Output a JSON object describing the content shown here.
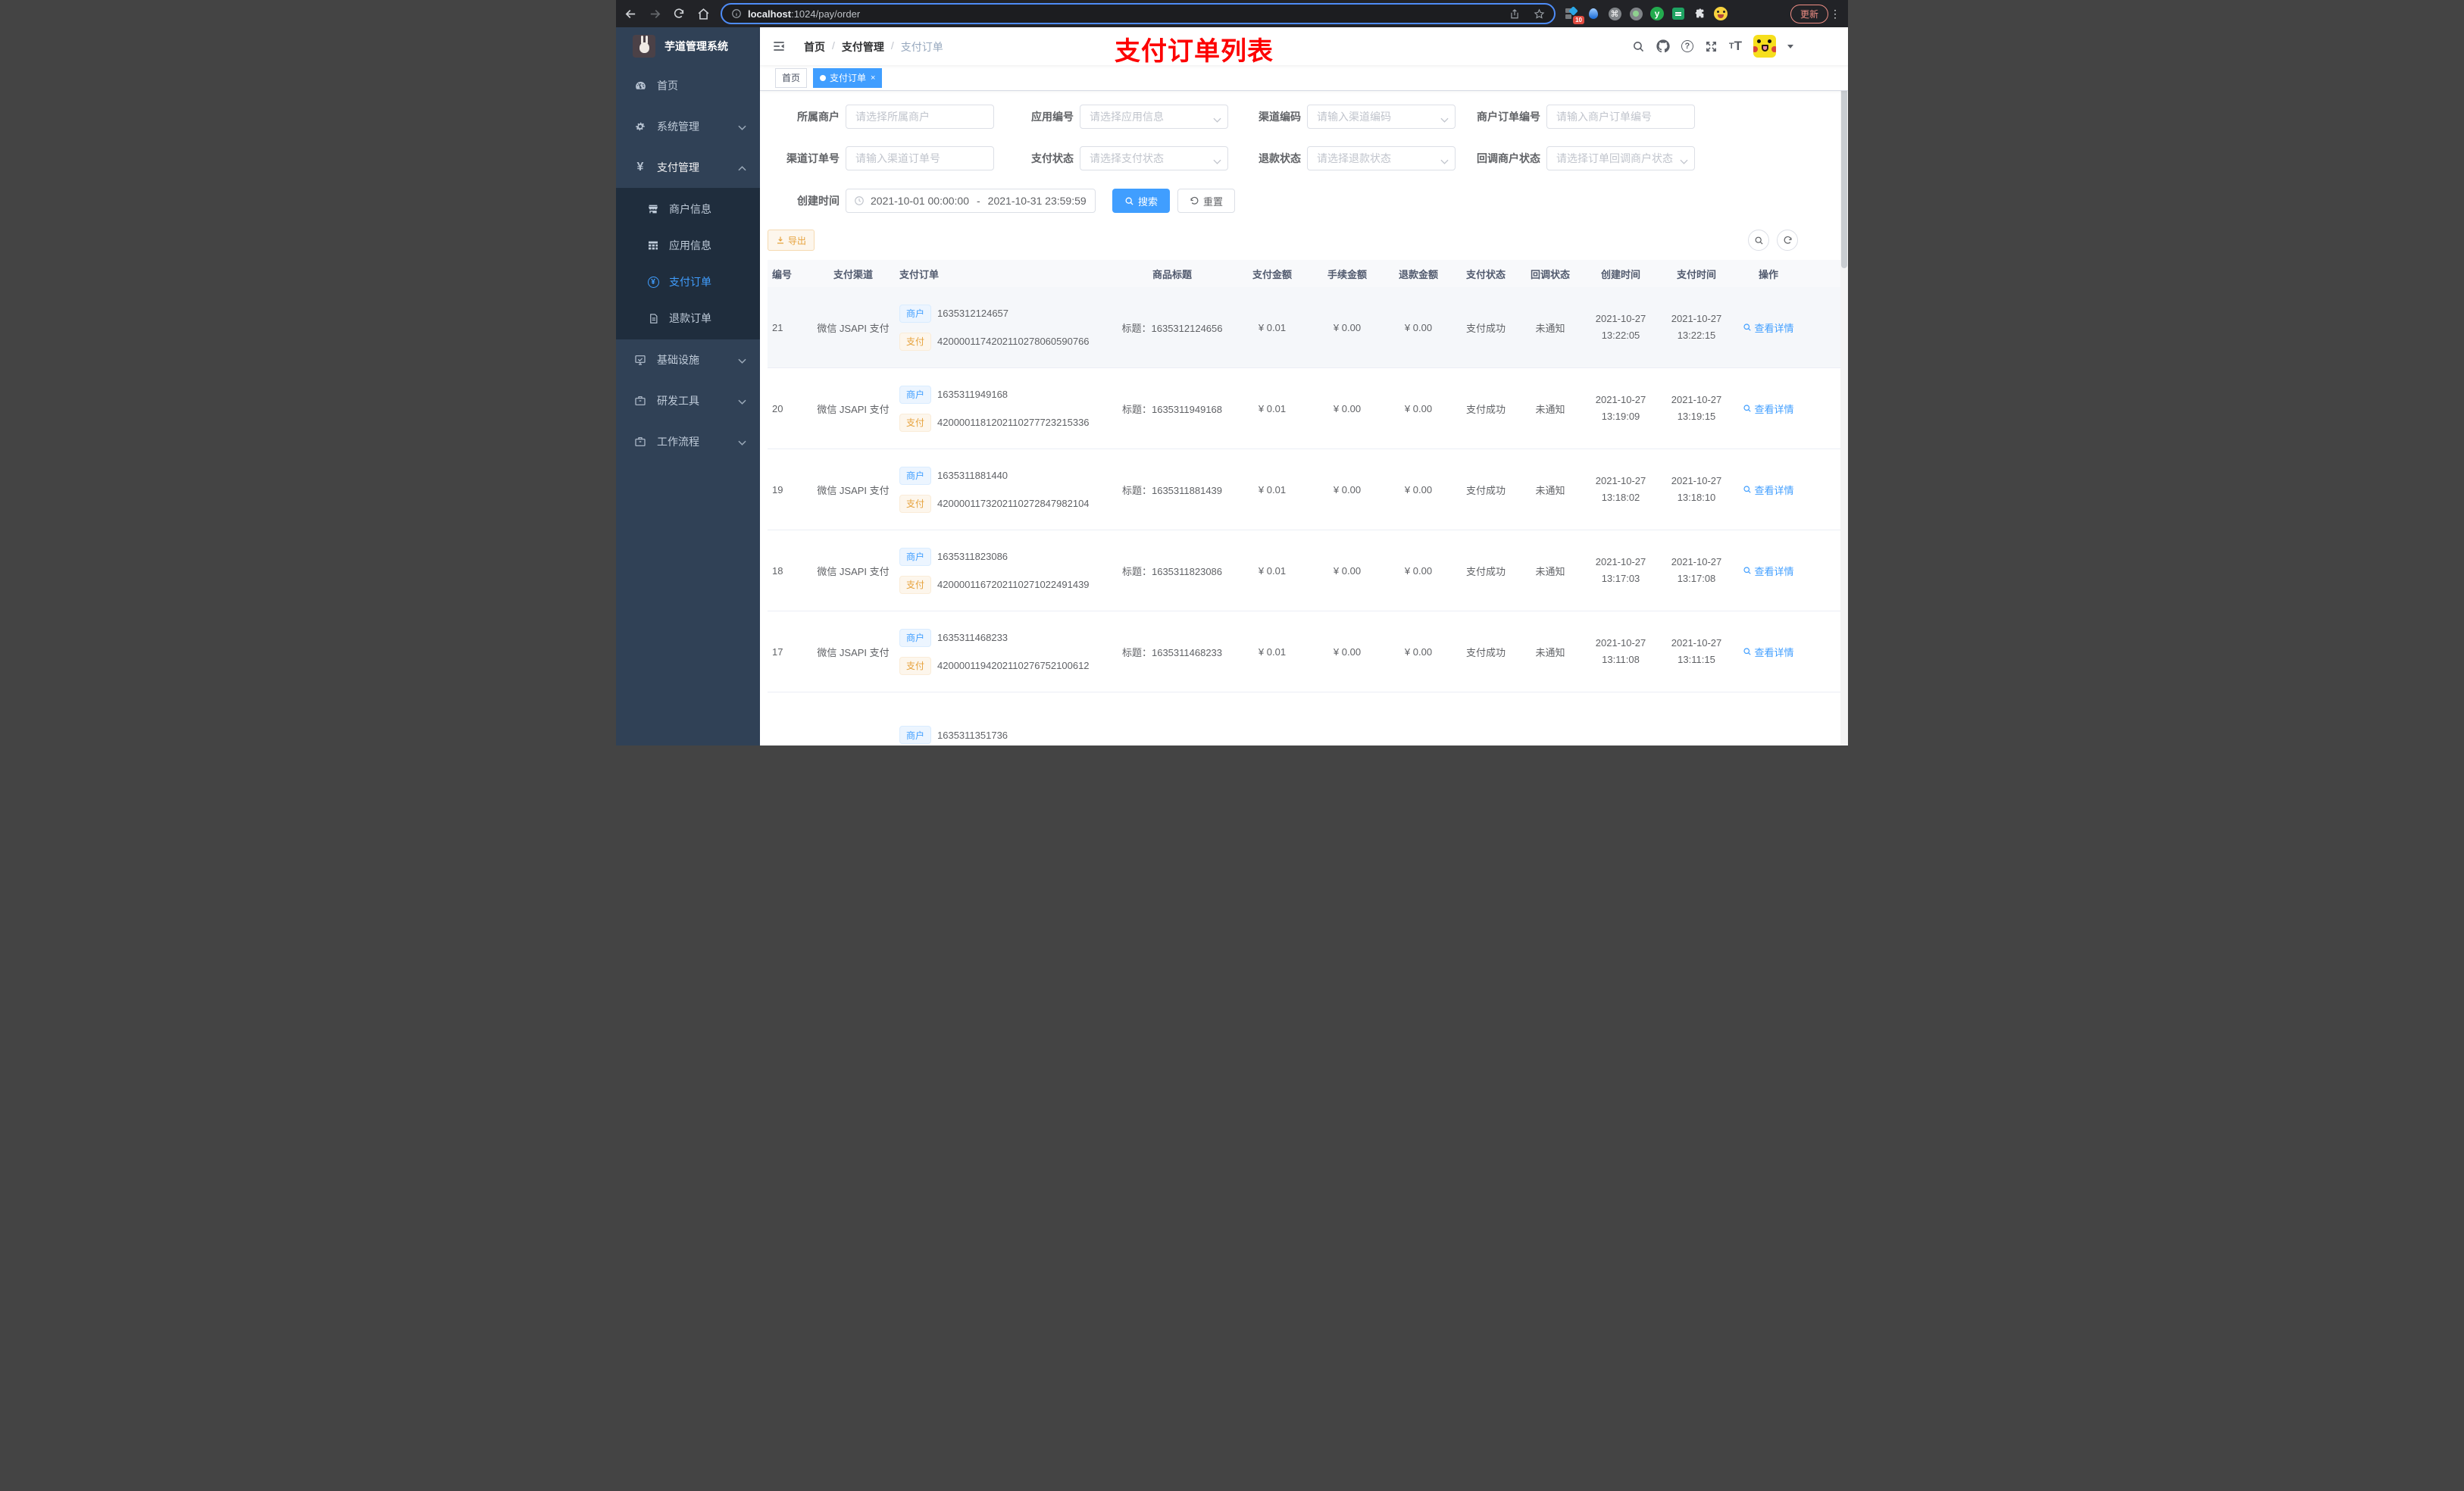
{
  "browser": {
    "url_host": "localhost",
    "url_rest": ":1024/pay/order",
    "update_label": "更新",
    "extension_badge": "10"
  },
  "sidebar": {
    "title": "芋道管理系统",
    "home": "首页",
    "system": "系统管理",
    "pay": "支付管理",
    "sub_merchant": "商户信息",
    "sub_app": "应用信息",
    "sub_order": "支付订单",
    "sub_refund": "退款订单",
    "infra": "基础设施",
    "devtool": "研发工具",
    "workflow": "工作流程"
  },
  "navbar": {
    "breadcrumb": [
      "首页",
      "支付管理",
      "支付订单"
    ],
    "annotation": "支付订单列表"
  },
  "tabs": [
    {
      "label": "首页"
    },
    {
      "label": "支付订单",
      "close": "×"
    }
  ],
  "filters": {
    "rows": [
      [
        {
          "label": "所属商户",
          "placeholder": "请选择所属商户"
        },
        {
          "label": "应用编号",
          "placeholder": "请选择应用信息"
        },
        {
          "label": "渠道编码",
          "placeholder": "请输入渠道编码"
        },
        {
          "label": "商户订单编号",
          "placeholder": "请输入商户订单编号"
        }
      ],
      [
        {
          "label": "渠道订单号",
          "placeholder": "请输入渠道订单号"
        },
        {
          "label": "支付状态",
          "placeholder": "请选择支付状态"
        },
        {
          "label": "退款状态",
          "placeholder": "请选择退款状态"
        },
        {
          "label": "回调商户状态",
          "placeholder": "请选择订单回调商户状态"
        }
      ]
    ],
    "date": {
      "label": "创建时间",
      "start": "2021-10-01 00:00:00",
      "sep": "-",
      "end": "2021-10-31 23:59:59"
    },
    "search_label": "搜索",
    "reset_label": "重置"
  },
  "toolbar": {
    "export_label": "导出"
  },
  "table": {
    "columns": [
      "编号",
      "支付渠道",
      "支付订单",
      "商品标题",
      "支付金额",
      "手续金额",
      "退款金额",
      "支付状态",
      "回调状态",
      "创建时间",
      "支付时间",
      "操作"
    ],
    "tag_merchant": "商户",
    "tag_pay": "支付",
    "action_label": "查看详情",
    "rows": [
      {
        "id": "21",
        "channel": "微信 JSAPI 支付",
        "merchant_no": "1635312124657",
        "pay_no": "4200001174202110278060590766",
        "title": "标题：1635312124656",
        "amount": "¥ 0.01",
        "fee": "¥ 0.00",
        "refund": "¥ 0.00",
        "status": "支付成功",
        "notify": "未通知",
        "created_date": "2021-10-27",
        "created_time": "13:22:05",
        "paid_date": "2021-10-27",
        "paid_time": "13:22:15"
      },
      {
        "id": "20",
        "channel": "微信 JSAPI 支付",
        "merchant_no": "1635311949168",
        "pay_no": "4200001181202110277723215336",
        "title": "标题：1635311949168",
        "amount": "¥ 0.01",
        "fee": "¥ 0.00",
        "refund": "¥ 0.00",
        "status": "支付成功",
        "notify": "未通知",
        "created_date": "2021-10-27",
        "created_time": "13:19:09",
        "paid_date": "2021-10-27",
        "paid_time": "13:19:15"
      },
      {
        "id": "19",
        "channel": "微信 JSAPI 支付",
        "merchant_no": "1635311881440",
        "pay_no": "4200001173202110272847982104",
        "title": "标题：1635311881439",
        "amount": "¥ 0.01",
        "fee": "¥ 0.00",
        "refund": "¥ 0.00",
        "status": "支付成功",
        "notify": "未通知",
        "created_date": "2021-10-27",
        "created_time": "13:18:02",
        "paid_date": "2021-10-27",
        "paid_time": "13:18:10"
      },
      {
        "id": "18",
        "channel": "微信 JSAPI 支付",
        "merchant_no": "1635311823086",
        "pay_no": "4200001167202110271022491439",
        "title": "标题：1635311823086",
        "amount": "¥ 0.01",
        "fee": "¥ 0.00",
        "refund": "¥ 0.00",
        "status": "支付成功",
        "notify": "未通知",
        "created_date": "2021-10-27",
        "created_time": "13:17:03",
        "paid_date": "2021-10-27",
        "paid_time": "13:17:08"
      },
      {
        "id": "17",
        "channel": "微信 JSAPI 支付",
        "merchant_no": "1635311468233",
        "pay_no": "4200001194202110276752100612",
        "title": "标题：1635311468233",
        "amount": "¥ 0.01",
        "fee": "¥ 0.00",
        "refund": "¥ 0.00",
        "status": "支付成功",
        "notify": "未通知",
        "created_date": "2021-10-27",
        "created_time": "13:11:08",
        "paid_date": "2021-10-27",
        "paid_time": "13:11:15"
      }
    ],
    "partial_row": {
      "merchant_no": "1635311351736"
    }
  }
}
